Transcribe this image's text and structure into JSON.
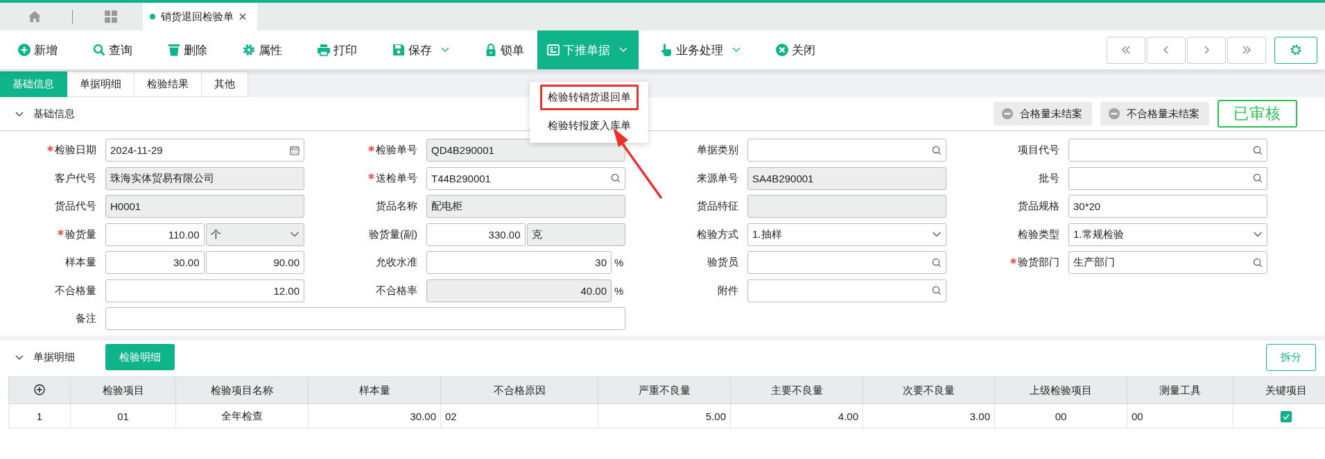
{
  "tab_bar": {
    "tabs": [
      {
        "label": "销货退回检验单",
        "selected": true
      }
    ]
  },
  "toolbar": {
    "buttons": [
      {
        "label": "新增",
        "kind": "plus",
        "dropdown": false,
        "selected": false
      },
      {
        "label": "查询",
        "kind": "search",
        "dropdown": false,
        "selected": false
      },
      {
        "label": "删除",
        "kind": "trash",
        "dropdown": false,
        "selected": false
      },
      {
        "label": "属性",
        "kind": "gear",
        "dropdown": false,
        "selected": false
      },
      {
        "label": "打印",
        "kind": "print",
        "dropdown": false,
        "selected": false
      },
      {
        "label": "保存",
        "kind": "save",
        "dropdown": true,
        "selected": false
      },
      {
        "label": "锁单",
        "kind": "lock",
        "dropdown": false,
        "selected": false
      },
      {
        "label": "下推单据",
        "kind": "doc",
        "dropdown": true,
        "selected": true
      },
      {
        "label": "业务处理",
        "kind": "hand",
        "dropdown": true,
        "selected": false
      },
      {
        "label": "关闭",
        "kind": "close",
        "dropdown": false,
        "selected": false
      }
    ]
  },
  "dropdown_menu": {
    "items": [
      {
        "label": "检验转销货退回单",
        "marked": true
      },
      {
        "label": "检验转报废入库单",
        "marked": false
      }
    ]
  },
  "section_tabs": [
    {
      "label": "基础信息",
      "selected": true
    },
    {
      "label": "单据明细",
      "selected": false
    },
    {
      "label": "检验结果",
      "selected": false
    },
    {
      "label": "其他",
      "selected": false
    }
  ],
  "basic_panel": {
    "title": "基础信息",
    "expanded": true,
    "status_tags": [
      {
        "label": "合格量未结案"
      },
      {
        "label": "不合格量未结案"
      }
    ],
    "stamp": "已审核",
    "rows": [
      [
        {
          "label": "检验日期",
          "required": true,
          "parts": [
            {
              "kind": "date",
              "value": "2024-11-29",
              "disabled": false
            }
          ]
        },
        {
          "label": "检验单号",
          "required": true,
          "parts": [
            {
              "kind": "text",
              "value": "QD4B290001",
              "disabled": true
            }
          ]
        },
        {
          "label": "单据类别",
          "required": false,
          "parts": [
            {
              "kind": "search",
              "disabled": false
            }
          ]
        },
        {
          "label": "项目代号",
          "required": false,
          "parts": [
            {
              "kind": "search",
              "disabled": false
            }
          ]
        }
      ],
      [
        {
          "label": "客户代号",
          "required": false,
          "parts": [
            {
              "kind": "text",
              "value": "珠海实体贸易有限公司",
              "disabled": true
            }
          ]
        },
        {
          "label": "送检单号",
          "required": true,
          "parts": [
            {
              "kind": "search",
              "value": "T44B290001",
              "disabled": false
            }
          ]
        },
        {
          "label": "来源单号",
          "required": false,
          "parts": [
            {
              "kind": "text",
              "value": "SA4B290001",
              "disabled": true
            }
          ]
        },
        {
          "label": "批号",
          "required": false,
          "parts": [
            {
              "kind": "search",
              "disabled": false
            }
          ]
        }
      ],
      [
        {
          "label": "货品代号",
          "required": false,
          "parts": [
            {
              "kind": "text",
              "value": "H0001",
              "disabled": true
            }
          ]
        },
        {
          "label": "货品名称",
          "required": false,
          "parts": [
            {
              "kind": "text",
              "value": "配电柜",
              "disabled": true
            }
          ]
        },
        {
          "label": "货品特征",
          "required": false,
          "parts": [
            {
              "kind": "text",
              "disabled": true
            }
          ]
        },
        {
          "label": "货品规格",
          "required": false,
          "parts": [
            {
              "kind": "text",
              "value": "30*20",
              "disabled": false
            }
          ]
        }
      ],
      [
        {
          "label": "验货量",
          "required": true,
          "parts": [
            {
              "kind": "number",
              "value": "110.00",
              "disabled": false
            },
            {
              "kind": "select",
              "value": "个",
              "disabled": true
            }
          ]
        },
        {
          "label": "验货量(副)",
          "required": false,
          "parts": [
            {
              "kind": "number",
              "value": "330.00",
              "disabled": false
            },
            {
              "kind": "text",
              "value": "克",
              "disabled": true
            }
          ]
        },
        {
          "label": "检验方式",
          "required": false,
          "parts": [
            {
              "kind": "select",
              "value": "1.抽样",
              "disabled": false
            }
          ]
        },
        {
          "label": "检验类型",
          "required": false,
          "parts": [
            {
              "kind": "select",
              "value": "1.常规检验",
              "disabled": false
            }
          ]
        }
      ],
      [
        {
          "label": "样本量",
          "required": false,
          "parts": [
            {
              "kind": "number",
              "value": "30.00",
              "disabled": false
            },
            {
              "kind": "number",
              "value": "90.00",
              "disabled": false
            }
          ]
        },
        {
          "label": "允收水准",
          "required": false,
          "suffix": "%",
          "parts": [
            {
              "kind": "number",
              "value": "30",
              "disabled": false
            }
          ]
        },
        {
          "label": "验货员",
          "required": false,
          "parts": [
            {
              "kind": "search",
              "disabled": false
            }
          ]
        },
        {
          "label": "验货部门",
          "required": true,
          "parts": [
            {
              "kind": "search",
              "value": "生产部门",
              "disabled": false
            }
          ]
        }
      ],
      [
        {
          "label": "不合格量",
          "required": false,
          "parts": [
            {
              "kind": "number",
              "value": "12.00",
              "disabled": false
            }
          ]
        },
        {
          "label": "不合格率",
          "required": false,
          "suffix": "%",
          "parts": [
            {
              "kind": "number",
              "value": "40.00",
              "disabled": true
            }
          ]
        },
        {
          "label": "附件",
          "required": false,
          "parts": [
            {
              "kind": "search",
              "disabled": false
            }
          ]
        }
      ],
      [
        {
          "label": "备注",
          "required": false,
          "wide": true,
          "parts": [
            {
              "kind": "text",
              "disabled": false
            }
          ]
        }
      ]
    ]
  },
  "detail_panel": {
    "title": "单据明细",
    "expanded": true,
    "tab_button": "检验明细",
    "split_button": "拆分",
    "table": {
      "columns": [
        {
          "label": "检验项目"
        },
        {
          "label": "检验项目名称"
        },
        {
          "label": "样本量"
        },
        {
          "label": "不合格原因"
        },
        {
          "label": "严重不良量"
        },
        {
          "label": "主要不良量"
        },
        {
          "label": "次要不良量"
        },
        {
          "label": "上级检验项目"
        },
        {
          "label": "测量工具"
        },
        {
          "label": "关键项目"
        }
      ],
      "rows": [
        {
          "number": "1",
          "cells": [
            "01",
            "全年检查",
            "30.00",
            "02",
            "5.00",
            "4.00",
            "3.00",
            "00",
            "00"
          ],
          "checked": true
        }
      ]
    }
  }
}
